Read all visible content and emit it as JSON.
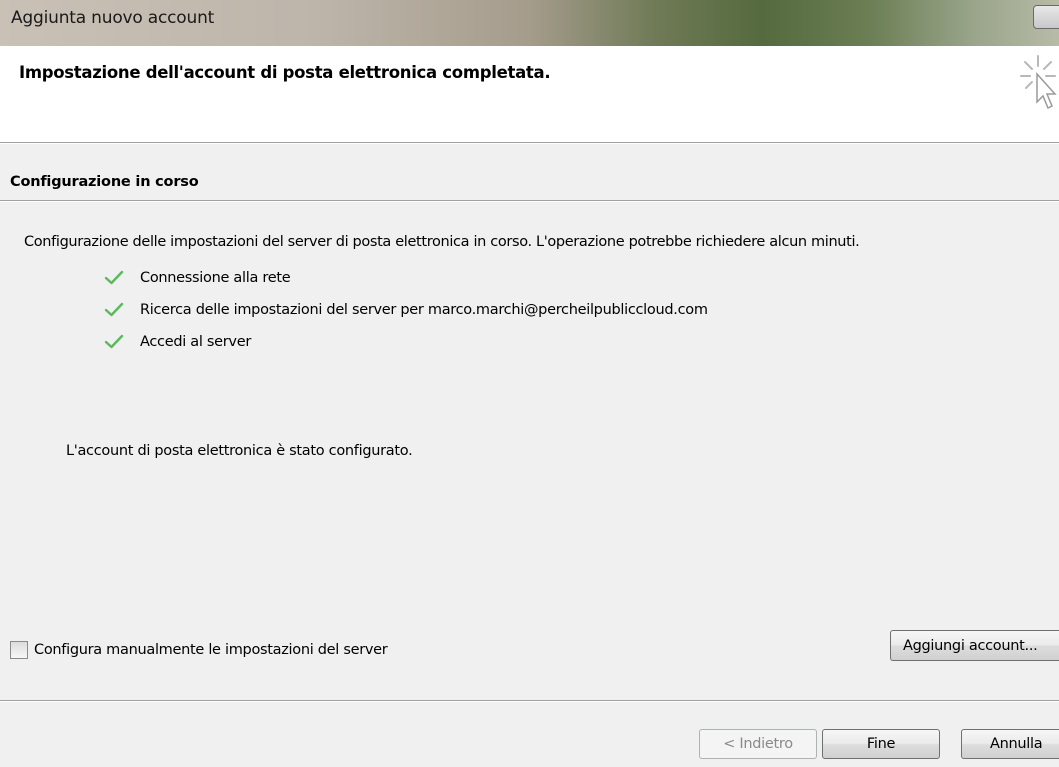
{
  "window": {
    "title": "Aggiunta nuovo account"
  },
  "header": {
    "title": "Impostazione dell'account di posta elettronica completata.",
    "icon": "wizard-cursor-icon"
  },
  "section": {
    "title": "Configurazione in corso",
    "intro": "Configurazione delle impostazioni del server di posta elettronica in corso. L'operazione potrebbe richiedere alcun minuti.",
    "steps": [
      {
        "label": "Connessione alla rete",
        "status": "done",
        "icon": "checkmark-icon"
      },
      {
        "label": "Ricerca delle impostazioni del server per marco.marchi@percheilpubliccloud.com",
        "status": "done",
        "icon": "checkmark-icon"
      },
      {
        "label": "Accedi al server",
        "status": "done",
        "icon": "checkmark-icon"
      }
    ],
    "result": "L'account di posta elettronica è stato configurato."
  },
  "options": {
    "manual_label": "Configura manualmente le impostazioni del server",
    "manual_checked": false,
    "add_account_label": "Aggiungi account..."
  },
  "footer": {
    "back_label": "< Indietro",
    "finish_label": "Fine",
    "cancel_label": "Annulla"
  },
  "colors": {
    "check": "#5cb85c",
    "background": "#f0f0f0",
    "header_bg": "#ffffff"
  }
}
